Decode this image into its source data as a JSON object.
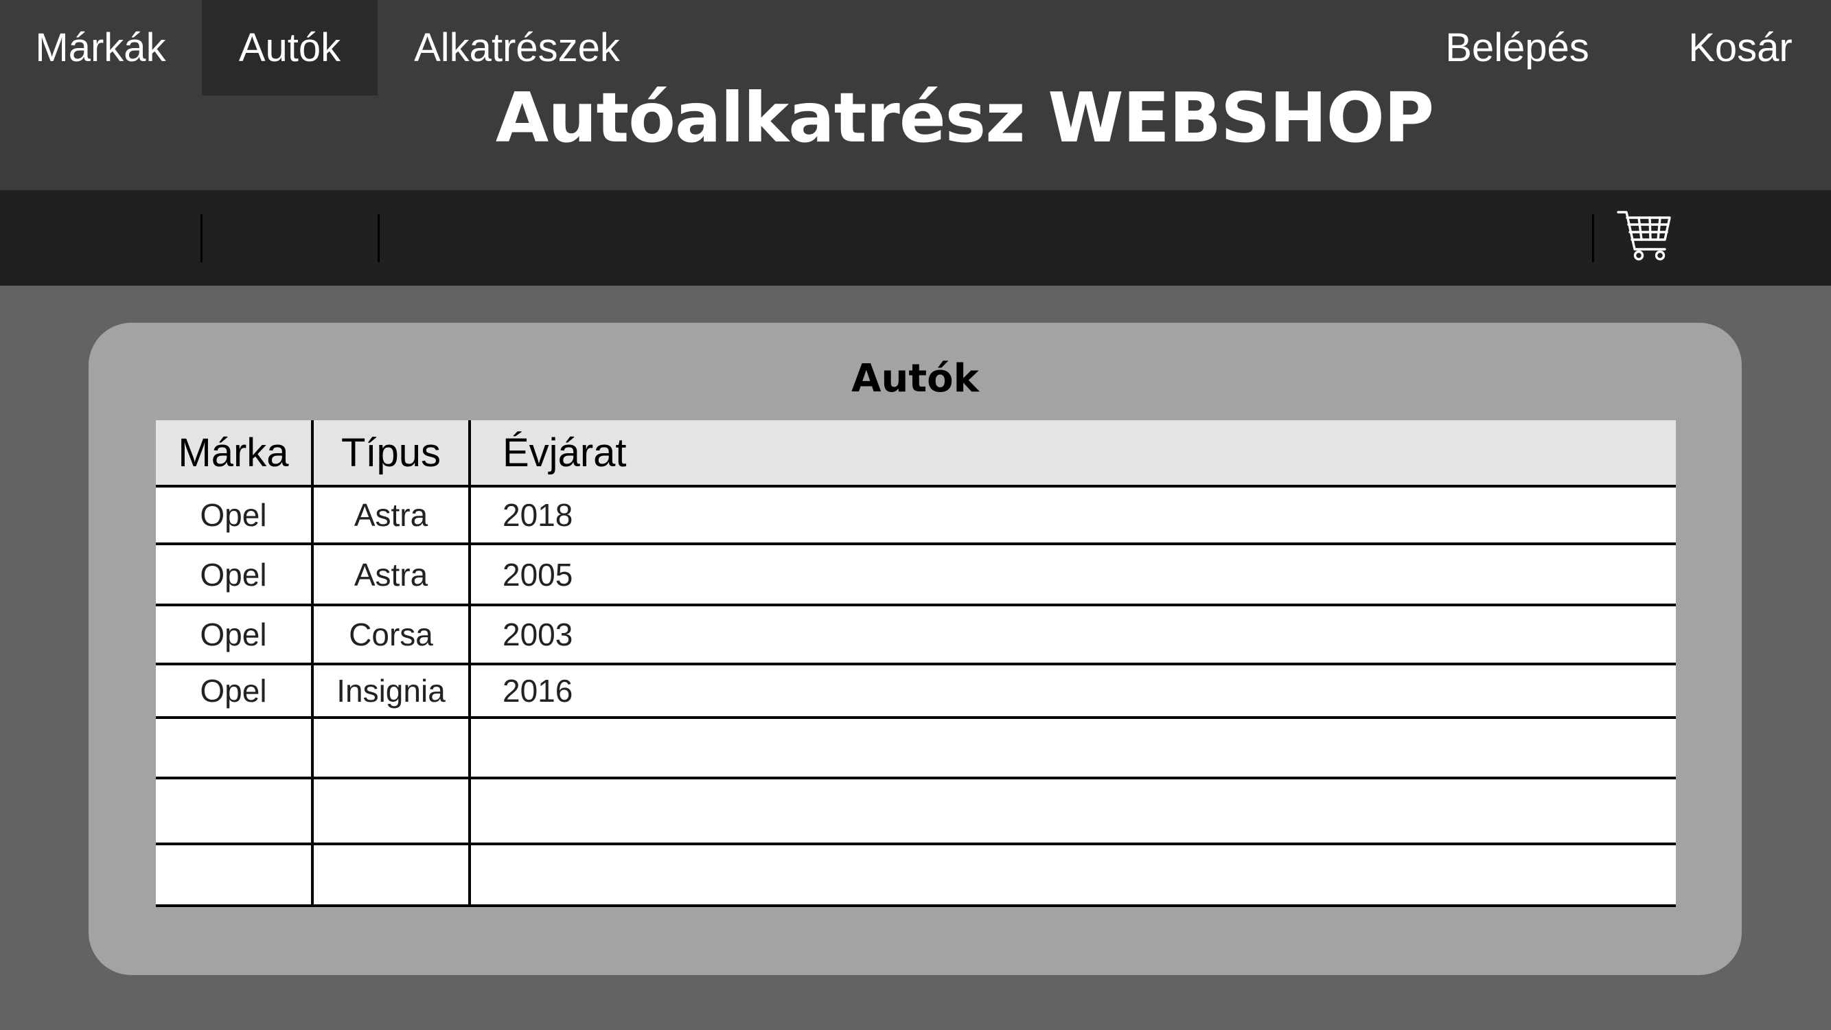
{
  "header": {
    "title": "Autóalkatrész WEBSHOP"
  },
  "nav": {
    "items": [
      {
        "label": "Márkák"
      },
      {
        "label": "Autók"
      },
      {
        "label": "Alkatrészek"
      }
    ],
    "login_label": "Belépés",
    "cart_label": "Kosár",
    "cart_icon": "shopping-cart-icon",
    "active_item": "Autók"
  },
  "panel": {
    "title": "Autók",
    "columns": [
      "Márka",
      "Típus",
      "Évjárat"
    ],
    "rows": [
      {
        "brand": "Opel",
        "type": "Astra",
        "year": "2018"
      },
      {
        "brand": "Opel",
        "type": "Astra",
        "year": "2005"
      },
      {
        "brand": "Opel",
        "type": "Corsa",
        "year": "2003"
      },
      {
        "brand": "Opel",
        "type": "Insignia",
        "year": "2016"
      },
      {
        "brand": "",
        "type": "",
        "year": ""
      },
      {
        "brand": "",
        "type": "",
        "year": ""
      },
      {
        "brand": "",
        "type": "",
        "year": ""
      }
    ]
  },
  "colors": {
    "header_bg": "#3c3c3c",
    "nav_bg": "#202020",
    "page_bg": "#636363",
    "panel_bg": "#a3a3a3",
    "table_header_bg": "#e4e4e4"
  }
}
